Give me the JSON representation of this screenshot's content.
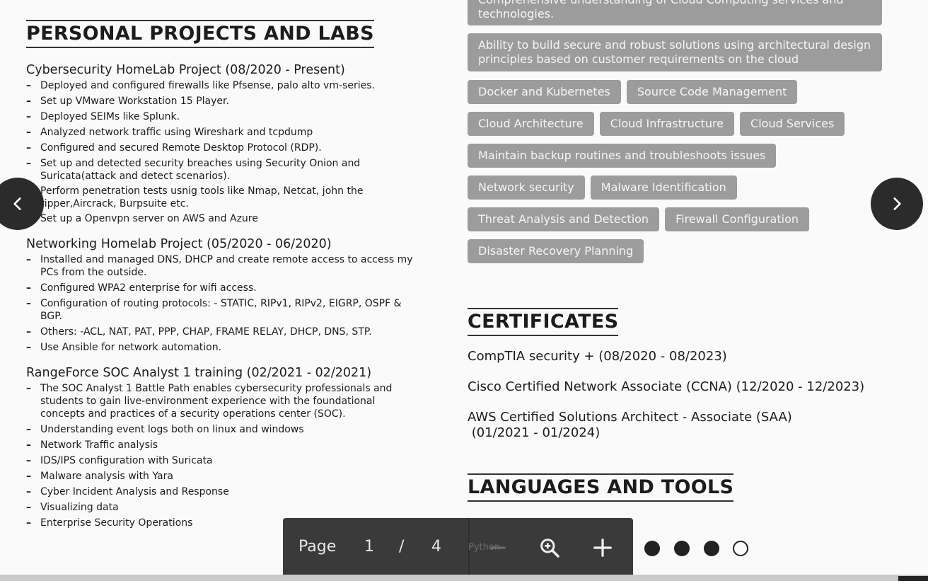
{
  "left": {
    "section_title": "PERSONAL PROJECTS AND LABS",
    "projects": [
      {
        "title": "Cybersecurity HomeLab Project (08/2020 - Present)",
        "items": [
          "Deployed and configured firewalls like Pfsense, palo alto vm-series.",
          "Set up VMware Workstation 15 Player.",
          "Deployed SEIMs like Splunk.",
          "Analyzed network traffic using Wireshark and tcpdump",
          "Configured and secured Remote Desktop Protocol (RDP).",
          "Set up and detected security breaches using Security Onion and Suricata(attack and detect scenarios).",
          "Perform penetration tests usnig tools like Nmap, Netcat, john the ripper,Aircrack, Burpsuite etc.",
          "Set up a Openvpn server on AWS and Azure"
        ]
      },
      {
        "title": "Networking Homelab Project (05/2020 - 06/2020)",
        "items": [
          "Installed and managed DNS, DHCP and create remote access to access my PCs from the outside.",
          "Configured WPA2 enterprise for wifi access.",
          "Configuration of routing protocols: - STATIC, RIPv1, RIPv2, EIGRP, OSPF & BGP.",
          "Others: -ACL, NAT, PAT, PPP, CHAP, FRAME RELAY, DHCP, DNS, STP.",
          "Use Ansible for network automation."
        ]
      },
      {
        "title": "RangeForce SOC Analyst 1 training (02/2021 - 02/2021)",
        "items": [
          "The SOC Analyst 1 Battle Path enables cybersecurity professionals and students to gain live-environment experience with the foundational concepts and practices of a security operations center (SOC).",
          "Understanding event logs both on linux and windows",
          "Network Traffic analysis",
          "IDS/IPS configuration with Suricata",
          "Malware analysis with Yara",
          "Cyber Incident Analysis and Response",
          "Visualizing data",
          "Enterprise Security Operations"
        ]
      }
    ]
  },
  "right": {
    "skill_rows": [
      [
        "Comprehensive understanding of Cloud Computing services and technologies."
      ],
      [
        "Ability to build secure and robust solutions using architectural design principles based on customer requirements on the cloud"
      ],
      [
        "Docker and Kubernetes",
        "Source Code Management"
      ],
      [
        "Cloud Architecture",
        "Cloud Infrastructure",
        "Cloud Services"
      ],
      [
        "Maintain backup routines and troubleshoots issues"
      ],
      [
        "Network security",
        "Malware Identification"
      ],
      [
        "Threat Analysis and Detection",
        "Firewall Configuration"
      ],
      [
        "Disaster Recovery Planning"
      ]
    ],
    "certificates_title": "CERTIFICATES",
    "certificates": [
      "CompTIA security + (08/2020 - 08/2023)",
      "Cisco Certified Network Associate (CCNA) (12/2020 - 12/2023)",
      "AWS Certified Solutions Architect - Associate (SAA)",
      " (01/2021 - 01/2024)"
    ],
    "languages_title": "LANGUAGES AND TOOLS",
    "language_partial": "Python",
    "rating": {
      "filled": 4,
      "total": 5
    }
  },
  "toolbar": {
    "page_label": "Page",
    "current_page": "1",
    "separator": "/",
    "total_pages": "4",
    "zoom_out_icon": "minus-icon",
    "zoom_icon": "magnifier-icon",
    "zoom_in_icon": "plus-icon"
  },
  "navigation": {
    "prev_icon": "chevron-left-icon",
    "next_icon": "chevron-right-icon"
  },
  "colors": {
    "tag_bg": "#9c9c9c",
    "toolbar_bg": "#3a3a3a",
    "nav_bg": "#2b2b2b"
  }
}
